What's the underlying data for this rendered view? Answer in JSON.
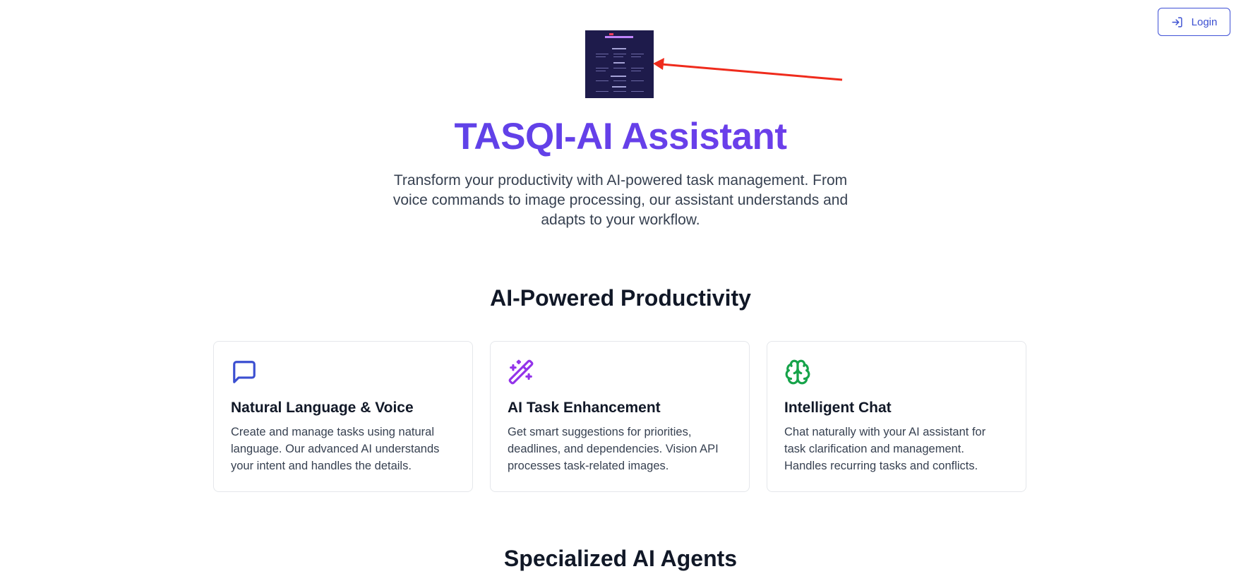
{
  "header": {
    "login_label": "Login"
  },
  "hero": {
    "title": "TASQI-AI Assistant",
    "subtitle": "Transform your productivity with AI-powered task management. From voice commands to image processing, our assistant understands and adapts to your workflow."
  },
  "features": {
    "heading": "AI-Powered Productivity",
    "cards": [
      {
        "title": "Natural Language & Voice",
        "description": "Create and manage tasks using natural language. Our advanced AI understands your intent and handles the details.",
        "icon": "message-square-icon",
        "color": "#3b4fd1"
      },
      {
        "title": "AI Task Enhancement",
        "description": "Get smart suggestions for priorities, deadlines, and dependencies. Vision API processes task-related images.",
        "icon": "magic-wand-icon",
        "color": "#9333ea"
      },
      {
        "title": "Intelligent Chat",
        "description": "Chat naturally with your AI assistant for task clarification and management. Handles recurring tasks and conflicts.",
        "icon": "brain-icon",
        "color": "#16a34a"
      }
    ]
  },
  "agents": {
    "heading": "Specialized AI Agents"
  },
  "colors": {
    "accent": "#4f46e5",
    "accent2": "#7c3aed",
    "annotation_arrow": "#ef2b1c"
  }
}
